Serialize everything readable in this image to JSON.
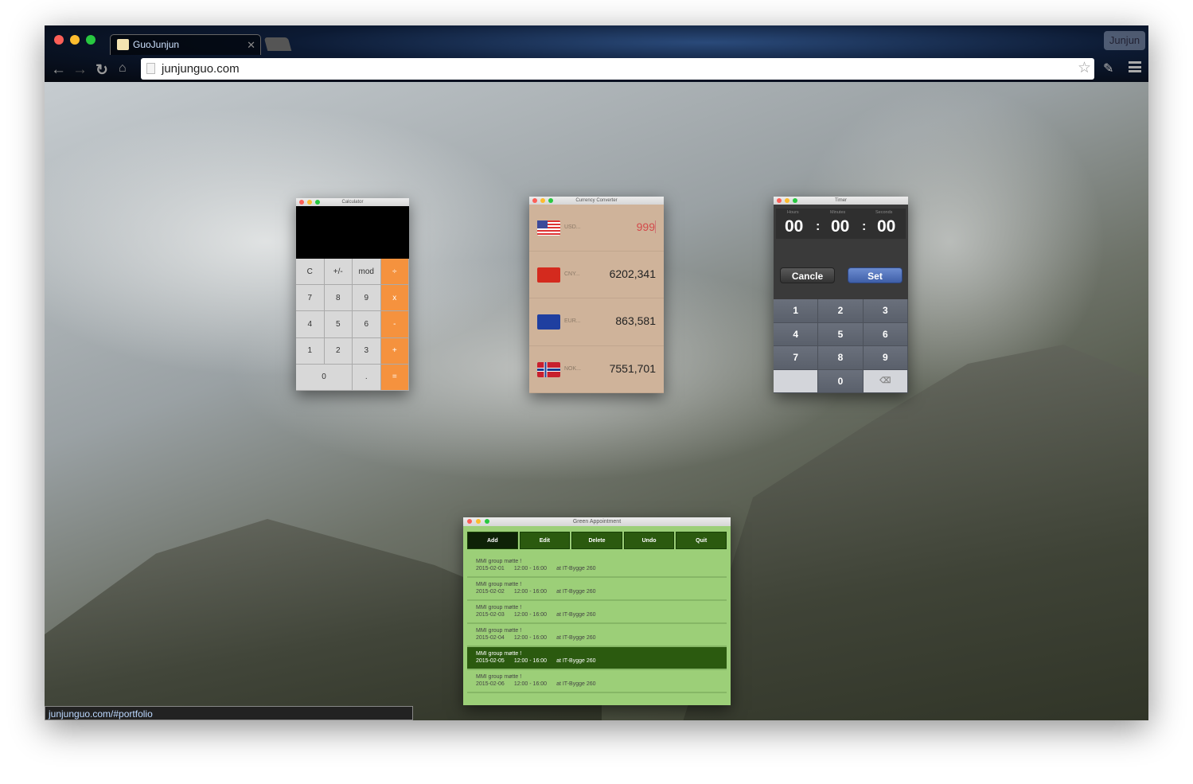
{
  "browser": {
    "tab_title": "GuoJunjun",
    "url": "junjunguo.com",
    "profile": "Junjun",
    "status_url": "junjunguo.com/#portfolio"
  },
  "calculator": {
    "title": "Calculator",
    "display": "",
    "keys": [
      "C",
      "+/-",
      "mod",
      "÷",
      "7",
      "8",
      "9",
      "x",
      "4",
      "5",
      "6",
      "-",
      "1",
      "2",
      "3",
      "+",
      "0",
      ".",
      "="
    ],
    "accent": "#f5923e"
  },
  "currency": {
    "title": "Currency Converter",
    "rows": [
      {
        "code": "USD...",
        "value": "999",
        "flag": "us"
      },
      {
        "code": "CNY...",
        "value": "6202,341",
        "flag": "cn"
      },
      {
        "code": "EUR...",
        "value": "863,581",
        "flag": "eu"
      },
      {
        "code": "NOK...",
        "value": "7551,701",
        "flag": "no"
      }
    ]
  },
  "timer": {
    "title": "Timer",
    "labels": {
      "hours": "Hours",
      "minutes": "Minutes",
      "seconds": "Seconds"
    },
    "hours": "00",
    "minutes": "00",
    "seconds": "00",
    "sep": ":",
    "cancel": "Cancle",
    "set": "Set",
    "keys": [
      "1",
      "2",
      "3",
      "4",
      "5",
      "6",
      "7",
      "8",
      "9",
      "",
      "0",
      "⌫"
    ]
  },
  "appointment": {
    "title": "Green Appointment",
    "buttons": [
      "Add",
      "Edit",
      "Delete",
      "Undo",
      "Quit"
    ],
    "items": [
      {
        "title": "MMI group møtte !",
        "date": "2015-02-01",
        "time": "12:00 - 16:00",
        "place": "at IT-Bygge 260"
      },
      {
        "title": "MMI group møtte !",
        "date": "2015-02-02",
        "time": "12:00 - 16:00",
        "place": "at IT-Bygge 260"
      },
      {
        "title": "MMI group møtte !",
        "date": "2015-02-03",
        "time": "12:00 - 16:00",
        "place": "at IT-Bygge 260"
      },
      {
        "title": "MMI group møtte !",
        "date": "2015-02-04",
        "time": "12:00 - 16:00",
        "place": "at IT-Bygge 260"
      },
      {
        "title": "MMI group møtte !",
        "date": "2015-02-05",
        "time": "12:00 - 16:00",
        "place": "at IT-Bygge 260",
        "selected": true
      },
      {
        "title": "MMI group møtte !",
        "date": "2015-02-06",
        "time": "12:00 - 16:00",
        "place": "at IT-Bygge 260"
      }
    ]
  }
}
